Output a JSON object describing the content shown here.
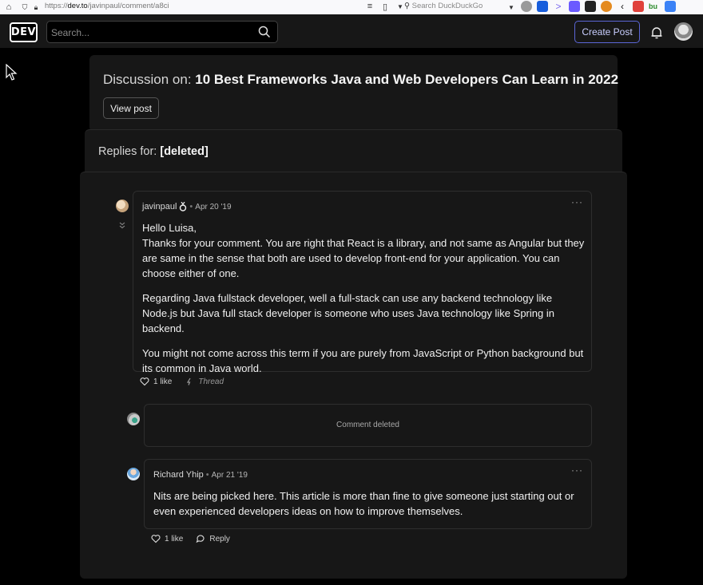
{
  "browser": {
    "url_scheme": "https://",
    "url_host": "dev.to",
    "url_path": "/javinpaul/comment/a8ci",
    "search_placeholder": "Search DuckDuckGo"
  },
  "header": {
    "logo": "DEV",
    "search_placeholder": "Search...",
    "create_post": "Create Post"
  },
  "discussion": {
    "prefix": "Discussion on: ",
    "title": "10 Best Frameworks Java and Web Developers Can Learn in 2022",
    "view_post": "View post"
  },
  "replies": {
    "prefix": "Replies for: ",
    "target": "[deleted]"
  },
  "comments": [
    {
      "author": "javinpaul",
      "date": "Apr 20 '19",
      "paragraphs": [
        "Hello Luisa,\nThanks for your comment. You are right that React is a library, and not same as Angular but they are same in the sense that both are used to develop front-end for your application. You can choose either of one.",
        "Regarding Java fullstack developer, well a full-stack can use any backend technology like Node.js but Java full stack developer is someone who uses Java technology like Spring in backend.",
        "You might not come across this term if you are purely from JavaScript or Python background but its common in Java world."
      ],
      "likes": "1 like",
      "thread": "Thread"
    },
    {
      "deleted_text": "Comment deleted"
    },
    {
      "author": "Richard Yhip",
      "date": "Apr 21 '19",
      "paragraphs": [
        "Nits are being picked here. This article is more than fine to give someone just starting out or even experienced developers ideas on how to improve themselves."
      ],
      "likes": "1 like",
      "reply": "Reply"
    }
  ],
  "more_glyph": "···",
  "dot_glyph": "•"
}
